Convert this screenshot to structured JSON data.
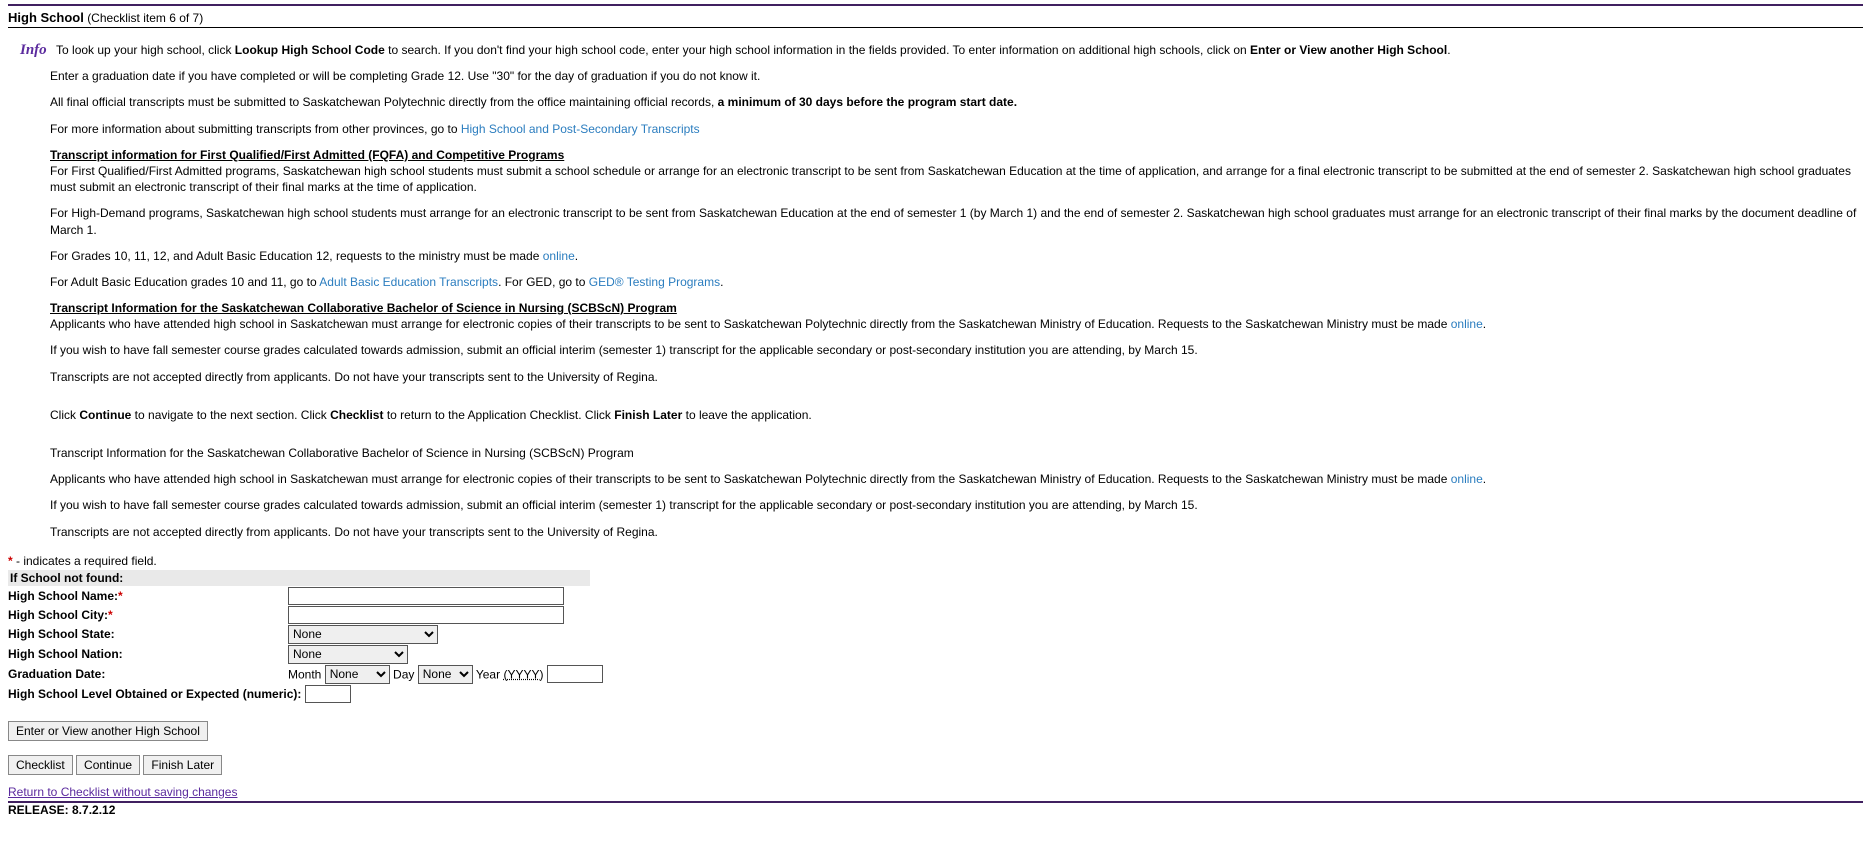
{
  "header": {
    "title": "High School",
    "subtitle": "(Checklist item 6 of 7)"
  },
  "info": {
    "label": "Info",
    "p1a": "To look up your high school, click ",
    "p1b": "Lookup High School Code",
    "p1c": " to search. If you don't find your high school code, enter your high school information in the fields provided. To enter information on additional high schools, click on ",
    "p1d": "Enter or View another High School",
    "p1e": ".",
    "p2": "Enter a graduation date if you have completed or will be completing Grade 12. Use \"30\" for the day of graduation if you do not know it.",
    "p3a": "All final official transcripts must be submitted to Saskatchewan Polytechnic directly from the office maintaining official records, ",
    "p3b": "a minimum of 30 days before the program start date.",
    "p4a": "For more information about submitting transcripts from other provinces, go to ",
    "p4b": "High School and Post-Secondary Transcripts",
    "h1": "Transcript information for First Qualified/First Admitted (FQFA) and Competitive Programs",
    "p5": "For First Qualified/First Admitted programs, Saskatchewan high school students must submit a school schedule or arrange for an electronic transcript to be sent from Saskatchewan Education at the time of application, and arrange for a final electronic transcript to be submitted at the end of semester 2. Saskatchewan high school graduates must submit an electronic transcript of their final marks at the time of application.",
    "p6": "For High-Demand programs, Saskatchewan high school students must arrange for an electronic transcript to be sent from Saskatchewan Education at the end of semester 1 (by March 1) and the end of semester 2. Saskatchewan high school graduates must arrange for an electronic transcript of their final marks by the document deadline of March 1.",
    "p7a": "For Grades 10, 11, 12, and Adult Basic Education 12, requests to the ministry must be made ",
    "p7b": "online",
    "p7c": ".",
    "p8a": "For Adult Basic Education grades 10 and 11, go to ",
    "p8b": "Adult Basic Education Transcripts",
    "p8c": ". For GED, go to ",
    "p8d": "GED® Testing Programs",
    "p8e": ".",
    "h2": "Transcript Information for the Saskatchewan Collaborative Bachelor of Science in Nursing (SCBScN) Program",
    "p9a": "Applicants who have attended high school in Saskatchewan must arrange for electronic copies of their transcripts to be sent to Saskatchewan Polytechnic directly from the Saskatchewan Ministry of Education. Requests to the Saskatchewan Ministry must be made ",
    "p9b": "online",
    "p9c": ".",
    "p10": "If you wish to have fall semester course grades calculated towards admission, submit an official interim (semester 1) transcript for the applicable secondary or post-secondary institution you are attending, by March 15.",
    "p11": "Transcripts are not accepted directly from applicants. Do not have your transcripts sent to the University of Regina.",
    "p12a": "Click ",
    "p12b": "Continue",
    "p12c": " to navigate to the next section. Click ",
    "p12d": "Checklist",
    "p12e": " to return to the Application Checklist. Click ",
    "p12f": "Finish Later",
    "p12g": " to leave the application.",
    "p13": "Transcript Information for the Saskatchewan Collaborative Bachelor of Science in Nursing (SCBScN) Program",
    "p14a": "Applicants who have attended high school in Saskatchewan must arrange for electronic copies of their transcripts to be sent to Saskatchewan Polytechnic directly from the Saskatchewan Ministry of Education. Requests to the Saskatchewan Ministry must be made ",
    "p14b": "online",
    "p14c": ".",
    "p15": "If you wish to have fall semester course grades calculated towards admission, submit an official interim (semester 1) transcript for the applicable secondary or post-secondary institution you are attending, by March 15.",
    "p16": "Transcripts are not accepted directly from applicants. Do not have your transcripts sent to the University of Regina."
  },
  "form": {
    "required_note": " - indicates a required field.",
    "section_label": "If School not found:",
    "hs_name_label": "High School Name:",
    "hs_city_label": "High School City:",
    "hs_state_label": "High School State:",
    "hs_nation_label": "High School Nation:",
    "grad_label": "Graduation Date:",
    "month_label": "Month",
    "day_label": "Day",
    "year_label": "Year",
    "year_hint": "(YYYY)",
    "level_label": "High School Level Obtained or Expected (numeric):",
    "state_option": "None",
    "nation_option": "None",
    "month_option": "None",
    "day_option": "None"
  },
  "buttons": {
    "enter_view": "Enter or View another High School",
    "checklist": "Checklist",
    "continue": "Continue",
    "finish_later": "Finish Later"
  },
  "footer": {
    "return_link": "Return to Checklist without saving changes",
    "release": "RELEASE: 8.7.2.12"
  }
}
